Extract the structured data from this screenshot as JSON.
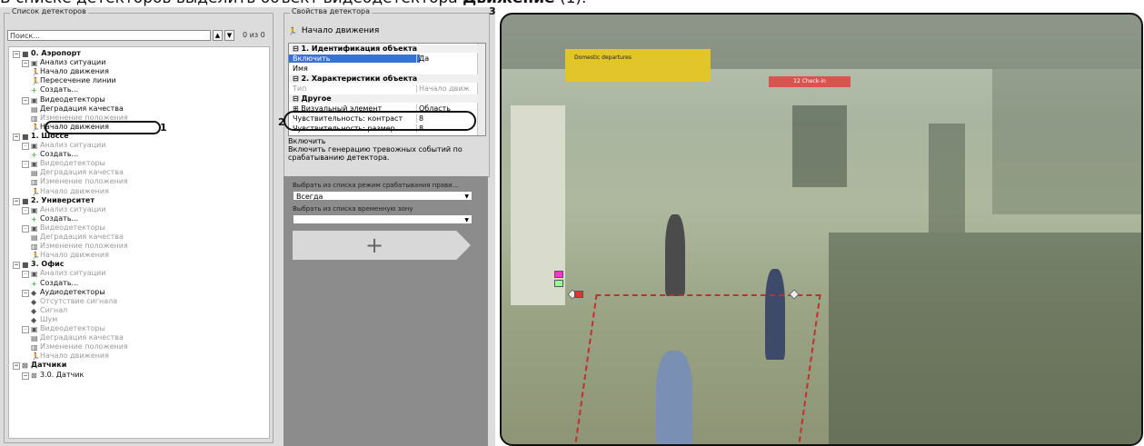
{
  "caption": {
    "prefix": "В списке детекторов выделить объект видеодетектора ",
    "bold": "Движение",
    "suffix": " (1)."
  },
  "left_panel": {
    "title": "Список детекторов",
    "search_placeholder": "Поиск...",
    "up_icon": "chevron-up-icon",
    "down_icon": "chevron-down-icon",
    "count": "0 из 0",
    "annotation": "1"
  },
  "tree": [
    {
      "label": "0. Аэропорт",
      "icon": "camera-icon",
      "style": "bold"
    },
    {
      "label": "Анализ ситуации",
      "icon": "group-icon",
      "style": ""
    },
    {
      "label": "Начало движения",
      "icon": "running-man-icon",
      "style": ""
    },
    {
      "label": "Пересечение линии",
      "icon": "running-man-icon",
      "style": ""
    },
    {
      "label": "Создать...",
      "icon": "plus-icon",
      "style": ""
    },
    {
      "label": "Видеодетекторы",
      "icon": "group-icon",
      "style": ""
    },
    {
      "label": "Деградация качества",
      "icon": "degradation-icon",
      "style": ""
    },
    {
      "label": "Изменение положения",
      "icon": "position-icon",
      "style": "dim"
    },
    {
      "label": "Начало движения",
      "icon": "running-man-icon",
      "style": "selected"
    },
    {
      "label": "1. Шоссе",
      "icon": "camera-icon",
      "style": "bold"
    },
    {
      "label": "Анализ ситуации",
      "icon": "group-icon",
      "style": "dim"
    },
    {
      "label": "Создать...",
      "icon": "plus-icon",
      "style": ""
    },
    {
      "label": "Видеодетекторы",
      "icon": "group-icon",
      "style": "dim"
    },
    {
      "label": "Деградация качества",
      "icon": "degradation-icon",
      "style": "dim"
    },
    {
      "label": "Изменение положения",
      "icon": "position-icon",
      "style": "dim"
    },
    {
      "label": "Начало движения",
      "icon": "running-man-icon",
      "style": "dim"
    },
    {
      "label": "2. Университет",
      "icon": "camera-icon",
      "style": "bold"
    },
    {
      "label": "Анализ ситуации",
      "icon": "group-icon",
      "style": "dim"
    },
    {
      "label": "Создать...",
      "icon": "plus-icon",
      "style": ""
    },
    {
      "label": "Видеодетекторы",
      "icon": "group-icon",
      "style": "dim"
    },
    {
      "label": "Деградация качества",
      "icon": "degradation-icon",
      "style": "dim"
    },
    {
      "label": "Изменение положения",
      "icon": "position-icon",
      "style": "dim"
    },
    {
      "label": "Начало движения",
      "icon": "running-man-icon",
      "style": "dim"
    },
    {
      "label": "3. Офис",
      "icon": "camera-icon",
      "style": "bold"
    },
    {
      "label": "Анализ ситуации",
      "icon": "group-icon",
      "style": "dim"
    },
    {
      "label": "Создать...",
      "icon": "plus-icon",
      "style": ""
    },
    {
      "label": "Аудиодетекторы",
      "icon": "audio-icon",
      "style": ""
    },
    {
      "label": "Отсутствие сигнала",
      "icon": "audio-signal-icon",
      "style": "dim"
    },
    {
      "label": "Сигнал",
      "icon": "audio-signal-icon",
      "style": "dim"
    },
    {
      "label": "Шум",
      "icon": "audio-signal-icon",
      "style": "dim"
    },
    {
      "label": "Видеодетекторы",
      "icon": "group-icon",
      "style": "dim"
    },
    {
      "label": "Деградация качества",
      "icon": "degradation-icon",
      "style": "dim"
    },
    {
      "label": "Изменение положения",
      "icon": "position-icon",
      "style": "dim"
    },
    {
      "label": "Начало движения",
      "icon": "running-man-icon",
      "style": "dim"
    },
    {
      "label": "Датчики",
      "icon": "sensor-icon",
      "style": "bold"
    },
    {
      "label": "3.0. Датчик",
      "icon": "sensor-icon",
      "style": ""
    }
  ],
  "props": {
    "title": "Свойства детектора",
    "header": "Начало движения",
    "annotation": "2",
    "rows": [
      {
        "key": "⊟ 1. Идентификация объекта",
        "value": "",
        "kind": "cat"
      },
      {
        "key": "Включить",
        "value": "Да",
        "kind": "sel"
      },
      {
        "key": "Имя",
        "value": "",
        "kind": ""
      },
      {
        "key": "⊟ 2. Характеристики объекта",
        "value": "",
        "kind": "cat"
      },
      {
        "key": "Тип",
        "value": "Начало движ",
        "kind": "dim"
      },
      {
        "key": "⊟ Другое",
        "value": "",
        "kind": "cat"
      },
      {
        "key": "⊞ Визуальный элемент",
        "value": "Область",
        "kind": ""
      },
      {
        "key": "Чувствительность: контраст",
        "value": "8",
        "kind": ""
      },
      {
        "key": "Чувствительность: размер",
        "value": "8",
        "kind": ""
      }
    ],
    "desc_title": "Включить",
    "desc_text": "Включить генерацию тревожных событий по срабатыванию детектора."
  },
  "schedule": {
    "mode_label": "Выбрать из списка режим срабатывания прави...",
    "mode_value": "Всегда",
    "zone_label": "Выбрать из списка временную зону",
    "zone_value": "",
    "add_label": "+"
  },
  "video": {
    "annotation": "3",
    "sign_text": "Domestic departures",
    "sign2_text": "12 Check-in"
  },
  "colors": {
    "selection": "#3574d4",
    "zone": "#c03030",
    "panel": "#dcdcdc"
  }
}
